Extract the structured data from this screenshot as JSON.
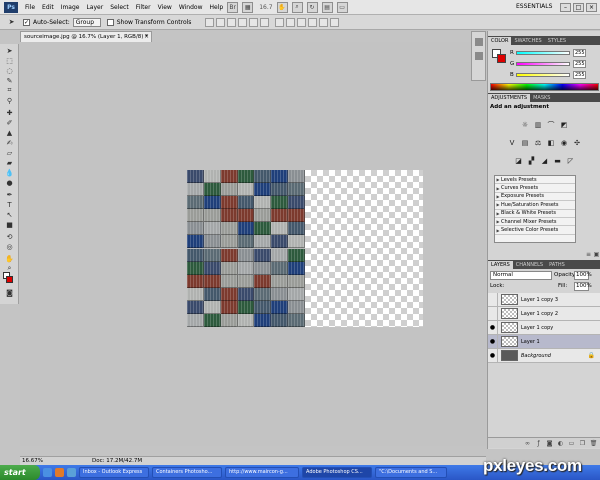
{
  "menubar": {
    "logo": "Ps",
    "menus": [
      "File",
      "Edit",
      "Image",
      "Layer",
      "Select",
      "Filter",
      "View",
      "Window",
      "Help"
    ],
    "zoom": "16.7",
    "workspace": "ESSENTIALS"
  },
  "options": {
    "auto_select_label": "Auto-Select:",
    "auto_select_value": "Group",
    "transform_label": "Show Transform Controls"
  },
  "document": {
    "tab_title": "sourceimage.jpg @ 16.7% (Layer 1, RGB/8) *",
    "close": "×"
  },
  "colors": {
    "accent": "#d00000",
    "container_palette": [
      "#3a4a6b",
      "#2d5a3d",
      "#8a8f93",
      "#a4a7a8",
      "#7c3a2e",
      "#1f3f7a",
      "#5b6b74",
      "#b0b2b0",
      "#44586b",
      "#9a9c98"
    ]
  },
  "canvas": {
    "status_zoom": "16.67%",
    "doc_size": "Doc: 17.2M/42.7M"
  },
  "color_panel": {
    "tabs": [
      "COLOR",
      "SWATCHES",
      "STYLES"
    ],
    "sliders": [
      {
        "letter": "R",
        "value": "255",
        "gradient": [
          "#00ffff",
          "#ffffff"
        ]
      },
      {
        "letter": "G",
        "value": "255",
        "gradient": [
          "#ff00ff",
          "#ffffff"
        ]
      },
      {
        "letter": "B",
        "value": "255",
        "gradient": [
          "#ffff00",
          "#ffffff"
        ]
      }
    ]
  },
  "adjustments": {
    "tabs": [
      "ADJUSTMENTS",
      "MASKS"
    ],
    "title": "Add an adjustment",
    "presets": [
      "Levels Presets",
      "Curves Presets",
      "Exposure Presets",
      "Hue/Saturation Presets",
      "Black & White Presets",
      "Channel Mixer Presets",
      "Selective Color Presets"
    ]
  },
  "layers": {
    "tabs": [
      "LAYERS",
      "CHANNELS",
      "PATHS"
    ],
    "blend_mode": "Normal",
    "opacity_label": "Opacity:",
    "opacity": "100%",
    "lock_label": "Lock:",
    "fill_label": "Fill:",
    "fill": "100%",
    "items": [
      {
        "name": "Layer 1 copy 3",
        "visible": false,
        "selected": false
      },
      {
        "name": "Layer 1 copy 2",
        "visible": false,
        "selected": false
      },
      {
        "name": "Layer 1 copy",
        "visible": true,
        "selected": false
      },
      {
        "name": "Layer 1",
        "visible": true,
        "selected": true
      },
      {
        "name": "Background",
        "visible": true,
        "selected": false
      }
    ]
  },
  "taskbar": {
    "start": "start",
    "tasks": [
      "Inbox - Outlook Express",
      "Containers Photosho...",
      "http://www.maircon-g...",
      "Adobe Photoshop CS...",
      "\"C:\\Documents and S..."
    ]
  },
  "watermark": "pxleyes.com"
}
